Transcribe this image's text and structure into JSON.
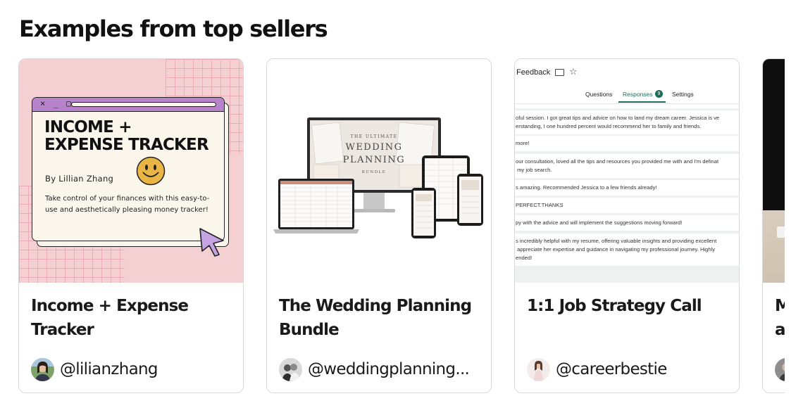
{
  "section": {
    "title": "Examples from top sellers"
  },
  "cards": [
    {
      "title": "Income + Expense Tracker",
      "seller": "@lilianzhang",
      "art": {
        "window_controls": "× _ ▢",
        "heading": "INCOME + EXPENSE TRACKER",
        "byline": "By Lillian Zhang",
        "description": "Take control of your finances with this easy-to-use and aesthetically pleasing money tracker!",
        "bg_color": "#f4d0d2",
        "accent_color": "#b784cc"
      }
    },
    {
      "title": "The Wedding Planning Bundle",
      "seller": "@weddingplanning...",
      "art": {
        "line1": "THE ULTIMATE",
        "line2": "WEDDING",
        "line3": "PLANNING",
        "line4": "BUNDLE"
      }
    },
    {
      "title": "1:1 Job Strategy Call",
      "seller": "@careerbestie",
      "art": {
        "form_title": "Feedback",
        "tabs": [
          "Questions",
          "Responses",
          "Settings"
        ],
        "response_count": "9",
        "accent_color": "#1e6b5c",
        "responses": [
          "oful session. I got great tips and advice on how to land my dream career. Jessica is ve\nerstanding, I one hundred percent would recommend her to family and friends.",
          "more!",
          "our consultation, loved all the tips and resources you provided me with and I'm definat\n my job search.",
          "s amazing. Recommended Jessica to a few friends already!",
          "PERFECT.THANKS",
          "py with the advice and will implement the suggestions moving forward!",
          "s incredibly helpful with my resume, offering valuable insights and providing excellent\n appreciate her expertise and guidance in navigating my professional journey. Highly\nended!"
        ]
      }
    },
    {
      "title": "M\na",
      "seller": ""
    }
  ]
}
